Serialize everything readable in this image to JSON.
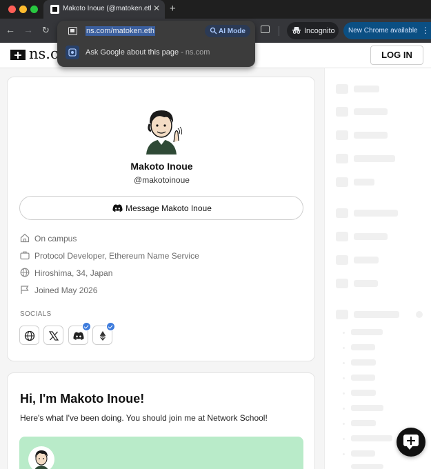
{
  "browser": {
    "tab_title": "Makoto Inoue (@matoken.eth",
    "tab_close": "✕",
    "new_tab": "+",
    "nav_back": "←",
    "nav_forward": "→",
    "nav_reload": "↻",
    "incognito_label": "Incognito",
    "new_chrome_label": "New Chrome available",
    "new_chrome_menu": "⋮",
    "omnibox": {
      "url": "ns.com/matoken.eth",
      "ai_mode_label": "AI Mode",
      "suggestion_text": "Ask Google about this page",
      "suggestion_domain": " - ns.com"
    }
  },
  "site": {
    "logo_text": "ns.co",
    "login_label": "LOG IN"
  },
  "profile": {
    "name": "Makoto Inoue",
    "handle": "@makotoinoue",
    "message_button": "Message Makoto Inoue",
    "details": [
      {
        "icon": "home-icon",
        "text": "On campus"
      },
      {
        "icon": "briefcase-icon",
        "text": "Protocol Developer, Ethereum Name Service"
      },
      {
        "icon": "globe-icon",
        "text": "Hiroshima, 34, Japan"
      },
      {
        "icon": "flag-icon",
        "text": "Joined May 2026"
      }
    ],
    "socials_label": "SOCIALS",
    "socials": [
      {
        "icon": "website-globe-icon",
        "verified": false
      },
      {
        "icon": "x-twitter-icon",
        "verified": false
      },
      {
        "icon": "discord-icon",
        "verified": true
      },
      {
        "icon": "ethereum-icon",
        "verified": true
      }
    ]
  },
  "intro": {
    "title": "Hi, I'm Makoto Inoue!",
    "body": "Here's what I've been doing. You should join me at Network School!"
  },
  "colors": {
    "accent_badge": "#3d7bdc",
    "highlight_green": "#b9ebc9",
    "new_chrome_bg": "#0b4f83"
  }
}
